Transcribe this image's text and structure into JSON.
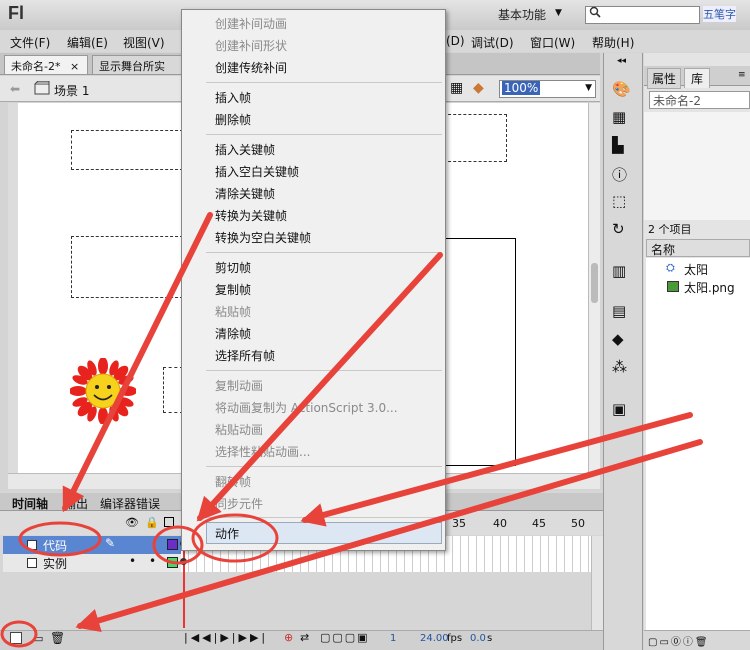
{
  "app": {
    "logo": "Fl",
    "workspace": "基本功能",
    "watermark": "五笔字"
  },
  "menubar": [
    "文件(F)",
    "编辑(E)",
    "视图(V)",
    "(D)",
    "调试(D)",
    "窗口(W)",
    "帮助(H)"
  ],
  "doc_tabs": [
    "未命名-2*",
    "×",
    "显示舞台所实"
  ],
  "scene": {
    "label": "场景 1",
    "zoom": "100%"
  },
  "context_menu": {
    "items": [
      {
        "label": "创建补间动画",
        "enabled": false
      },
      {
        "label": "创建补间形状",
        "enabled": false
      },
      {
        "label": "创建传统补间",
        "enabled": true
      },
      {
        "label": "插入帧",
        "enabled": true
      },
      {
        "label": "删除帧",
        "enabled": true
      },
      {
        "label": "插入关键帧",
        "enabled": true
      },
      {
        "label": "插入空白关键帧",
        "enabled": true
      },
      {
        "label": "清除关键帧",
        "enabled": true
      },
      {
        "label": "转换为关键帧",
        "enabled": true
      },
      {
        "label": "转换为空白关键帧",
        "enabled": true
      },
      {
        "label": "剪切帧",
        "enabled": true
      },
      {
        "label": "复制帧",
        "enabled": true
      },
      {
        "label": "粘贴帧",
        "enabled": false
      },
      {
        "label": "清除帧",
        "enabled": true
      },
      {
        "label": "选择所有帧",
        "enabled": true
      },
      {
        "label": "复制动画",
        "enabled": false
      },
      {
        "label": "将动画复制为 ActionScript 3.0...",
        "enabled": false
      },
      {
        "label": "粘贴动画",
        "enabled": false
      },
      {
        "label": "选择性粘贴动画...",
        "enabled": false
      },
      {
        "label": "翻转帧",
        "enabled": false
      },
      {
        "label": "同步元件",
        "enabled": false
      },
      {
        "label": "动作",
        "enabled": true
      }
    ]
  },
  "timeline": {
    "tabs": [
      "时间轴",
      "输出",
      "编译器错误"
    ],
    "frame_numbers": [
      "35",
      "40",
      "45",
      "50"
    ],
    "layers": [
      {
        "name": "代码"
      },
      {
        "name": "实例"
      }
    ],
    "status": {
      "frame": "1",
      "fps": "24.00",
      "fps_unit": "fps",
      "time": "0.0",
      "time_unit": "s"
    }
  },
  "right_panel": {
    "tabs": [
      "属性",
      "库"
    ],
    "document": "未命名-2",
    "count": "2 个项目",
    "column": "名称",
    "items": [
      "太阳",
      "太阳.png"
    ]
  },
  "colors": {
    "accent": "#3a64b8",
    "arrow": "#e8433a",
    "selected_layer": "#5a85d0"
  }
}
